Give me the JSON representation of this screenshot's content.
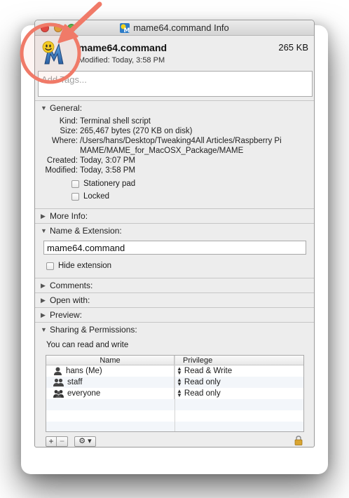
{
  "window": {
    "title": "mame64.command Info"
  },
  "header": {
    "file_name": "mame64.command",
    "file_size": "265 KB",
    "modified": "Modified: Today, 3:58 PM"
  },
  "tags": {
    "placeholder": "Add Tags..."
  },
  "general": {
    "label": "General:",
    "rows": [
      {
        "key": "Kind:",
        "value": "Terminal shell script"
      },
      {
        "key": "Size:",
        "value": "265,467 bytes (270 KB on disk)"
      },
      {
        "key": "Where:",
        "value": "/Users/hans/Desktop/Tweaking4All Articles/Raspberry Pi MAME/MAME_for_MacOSX_Package/MAME"
      },
      {
        "key": "Created:",
        "value": "Today, 3:07 PM"
      },
      {
        "key": "Modified:",
        "value": "Today, 3:58 PM"
      }
    ],
    "stationery_label": "Stationery pad",
    "locked_label": "Locked"
  },
  "more_info": {
    "label": "More Info:"
  },
  "name_extension": {
    "label": "Name & Extension:",
    "value": "mame64.command",
    "hide_extension_label": "Hide extension"
  },
  "comments": {
    "label": "Comments:"
  },
  "open_with": {
    "label": "Open with:"
  },
  "preview": {
    "label": "Preview:"
  },
  "sharing": {
    "label": "Sharing & Permissions:",
    "note": "You can read and write",
    "col_name": "Name",
    "col_privilege": "Privilege",
    "rows": [
      {
        "name": "hans (Me)",
        "privilege": "Read & Write",
        "icon": "single-user-icon"
      },
      {
        "name": "staff",
        "privilege": "Read only",
        "icon": "group-icon"
      },
      {
        "name": "everyone",
        "privilege": "Read only",
        "icon": "everyone-group-icon"
      }
    ],
    "add_label": "+",
    "remove_label": "−",
    "gear_label": "⚙ ▾"
  },
  "colors": {
    "annotation_circle": "#f07a68",
    "window_bg": "#ededed"
  }
}
